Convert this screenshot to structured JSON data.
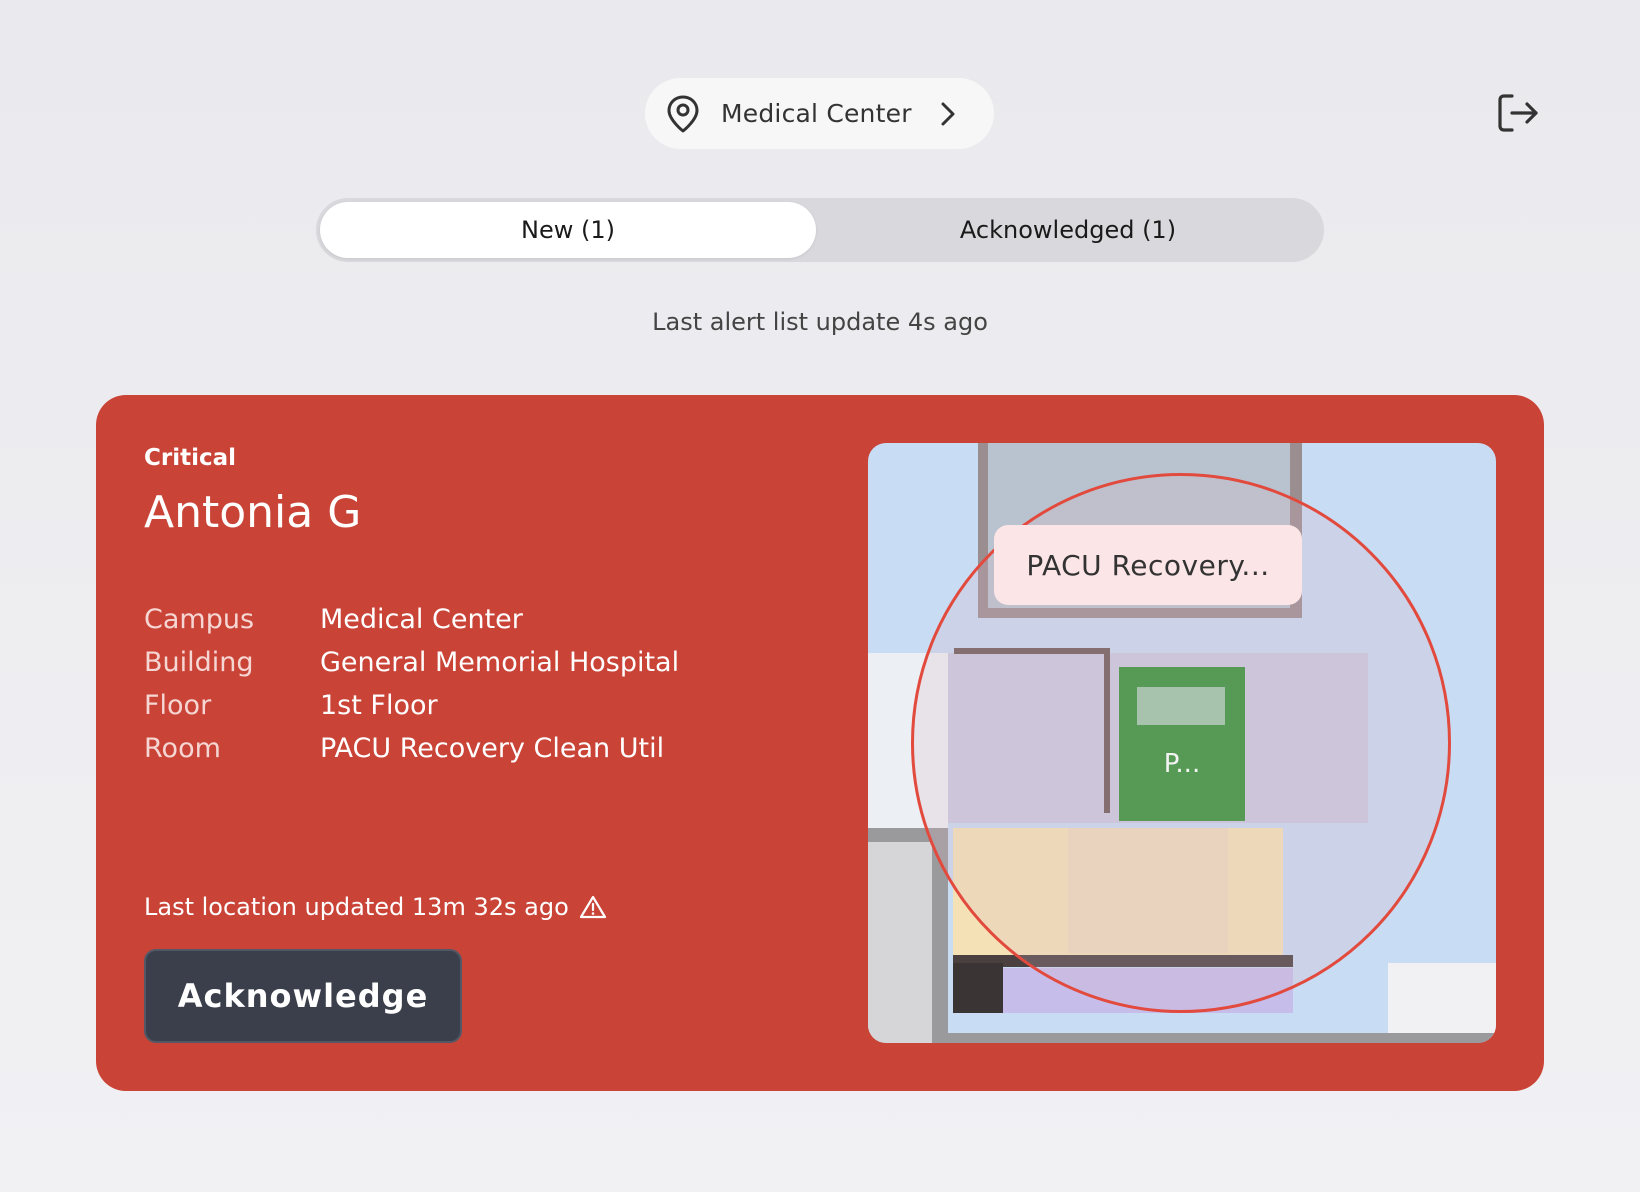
{
  "header": {
    "location_label": "Medical Center"
  },
  "tabs": [
    {
      "label": "New (1)",
      "active": true
    },
    {
      "label": "Acknowledged (1)",
      "active": false
    }
  ],
  "status": {
    "last_update": "Last alert list update 4s ago"
  },
  "alert": {
    "severity": "Critical",
    "patient_name": "Antonia G",
    "details": [
      {
        "key": "Campus",
        "value": "Medical Center"
      },
      {
        "key": "Building",
        "value": "General Memorial Hospital"
      },
      {
        "key": "Floor",
        "value": "1st Floor"
      },
      {
        "key": "Room",
        "value": "PACU Recovery Clean Util"
      }
    ],
    "last_location": "Last location updated 13m 32s ago",
    "acknowledge_label": "Acknowledge",
    "card_color": "#c94337",
    "map": {
      "room_label": "PACU Recovery...",
      "marker_label": "P..."
    }
  },
  "icons": {
    "location": "map-pin-icon",
    "chevron": "chevron-right-icon",
    "logout": "logout-icon",
    "warning": "warning-triangle-icon"
  }
}
